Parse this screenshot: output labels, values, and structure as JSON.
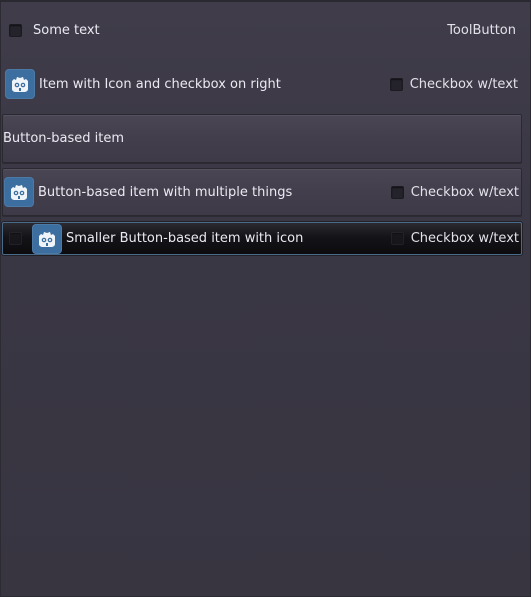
{
  "rows": [
    {
      "label": "Some text",
      "right_label": "ToolButton"
    },
    {
      "label": "Item with Icon and checkbox on right",
      "right_label": "Checkbox w/text"
    },
    {
      "label": "Button-based item"
    },
    {
      "label": "Button-based item with multiple things",
      "right_label": "Checkbox w/text"
    },
    {
      "label": "Smaller Button-based item with icon",
      "right_label": "Checkbox w/text"
    }
  ],
  "colors": {
    "background": "#3b3845",
    "icon_bg": "#3c6fa0",
    "selection_border": "#4a6a8a"
  },
  "icons": {
    "row_icon": "godot-icon"
  }
}
